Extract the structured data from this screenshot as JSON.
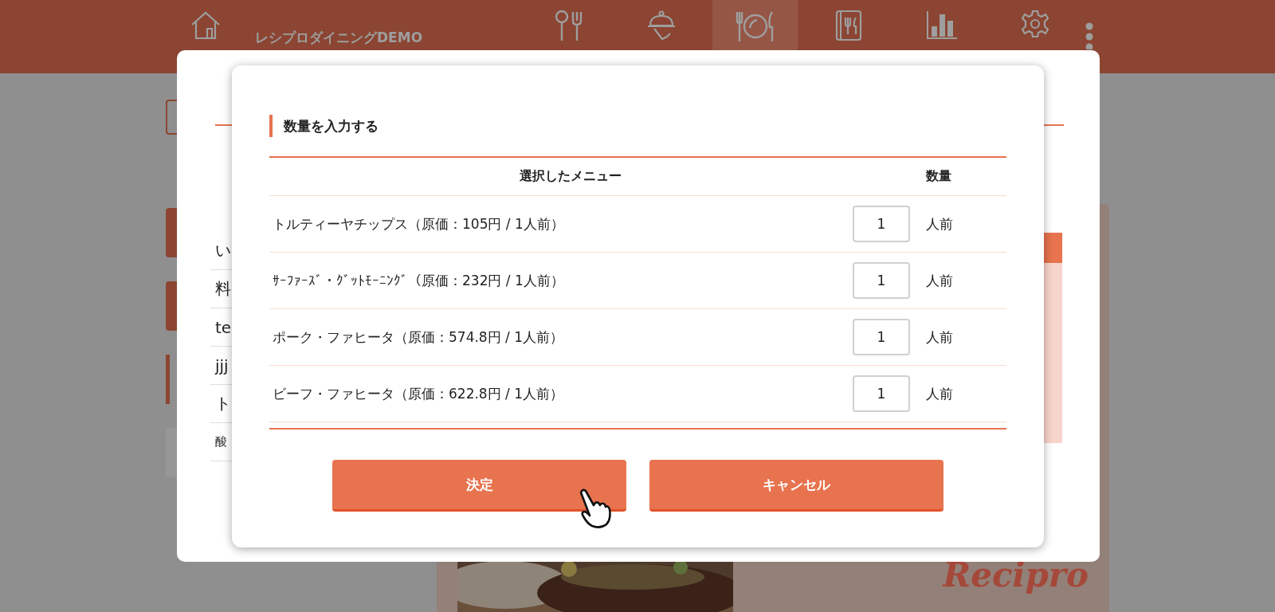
{
  "header": {
    "title": "レシプロダイニングDEMO",
    "nav": [
      {
        "kind": "cutlery",
        "selected": false
      },
      {
        "kind": "cloche",
        "selected": false
      },
      {
        "kind": "plate",
        "selected": true
      },
      {
        "kind": "menu-book",
        "selected": false
      },
      {
        "kind": "chart",
        "selected": false
      },
      {
        "kind": "settings",
        "selected": false
      }
    ]
  },
  "background_dialog": {
    "items": [
      "い",
      "料",
      "te",
      "jjj",
      "ト",
      "酸"
    ]
  },
  "page": {
    "logo": "Recipro"
  },
  "dialog": {
    "heading": "数量を入力する",
    "columns": [
      "選択したメニュー",
      "数量"
    ],
    "rows": [
      {
        "name": "トルティーヤチップス（原価：105円 / 1人前）",
        "quantity": "1",
        "unit": "人前"
      },
      {
        "name": "ｻｰﾌｧｰｽﾞ・ｸﾞｯﾄﾓｰﾆﾝｸﾞ（原価：232円 / 1人前）",
        "quantity": "1",
        "unit": "人前"
      },
      {
        "name": "ポーク・ファヒータ（原価：574.8円 / 1人前）",
        "quantity": "1",
        "unit": "人前"
      },
      {
        "name": "ビーフ・ファヒータ（原価：622.8円 / 1人前）",
        "quantity": "1",
        "unit": "人前"
      }
    ],
    "buttons": [
      "決定",
      "キャンセル"
    ]
  }
}
